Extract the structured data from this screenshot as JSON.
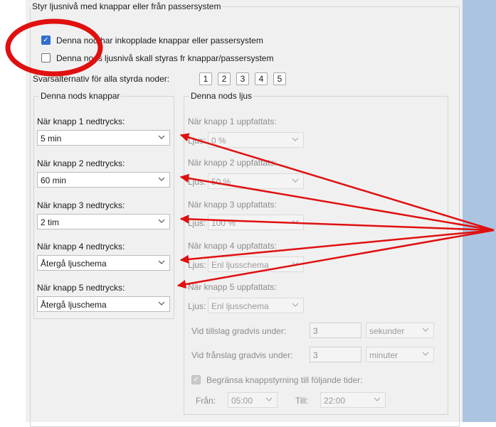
{
  "outer_group": {
    "title": "Styr ljusnivå med knappar eller från passersystem",
    "checkbox_has_buttons": {
      "label": "Denna nod har inkopplade knappar eller passersystem",
      "checked": true
    },
    "checkbox_light_level": {
      "label": "Denna nods ljusnivå skall styras fr knappar/passersystem",
      "checked": false
    },
    "button_numbers_label": "Svarsalternativ för alla styrda noder:",
    "button_numbers": [
      "1",
      "2",
      "3",
      "4",
      "5"
    ]
  },
  "node_buttons": {
    "title": "Denna nods knappar",
    "items": [
      {
        "label": "När knapp 1 nedtrycks:",
        "value": "5 min"
      },
      {
        "label": "När knapp 2 nedtrycks:",
        "value": "60 min"
      },
      {
        "label": "När knapp 3 nedtrycks:",
        "value": "2 tim"
      },
      {
        "label": "När knapp 4 nedtrycks:",
        "value": "Återgå ljuschema"
      },
      {
        "label": "När knapp 5 nedtrycks:",
        "value": "Återgå ljuschema"
      }
    ]
  },
  "node_light": {
    "title": "Denna nods ljus",
    "light_prefix": "Ljus:",
    "items": [
      {
        "label": "När knapp 1 uppfattats:",
        "value": "0 %"
      },
      {
        "label": "När knapp 2 uppfattats:",
        "value": "50 %"
      },
      {
        "label": "När knapp 3 uppfattats:",
        "value": "100 %"
      },
      {
        "label": "När knapp 4 uppfattats:",
        "value": "Enl ljusschema"
      },
      {
        "label": "När knapp 5 uppfattats:",
        "value": "Enl ljusschema"
      }
    ],
    "fade_on": {
      "label": "Vid tillslag gradvis under:",
      "value": "3",
      "unit": "sekunder"
    },
    "fade_off": {
      "label": "Vid frånslag gradvis under:",
      "value": "3",
      "unit": "minuter"
    },
    "limit_times": {
      "label": "Begränsa knappstyrning till följande tider:",
      "checked": true,
      "from_label": "Från:",
      "from_value": "05:00",
      "to_label": "Till:",
      "to_value": "22:00"
    }
  },
  "colors": {
    "annotation": "#e01010",
    "checkbox_accent": "#2f6fcf",
    "window_bg": "#f0f0f0",
    "side_bg": "#aac4e2"
  },
  "icons": [
    "check-icon",
    "chevron-down-icon"
  ]
}
